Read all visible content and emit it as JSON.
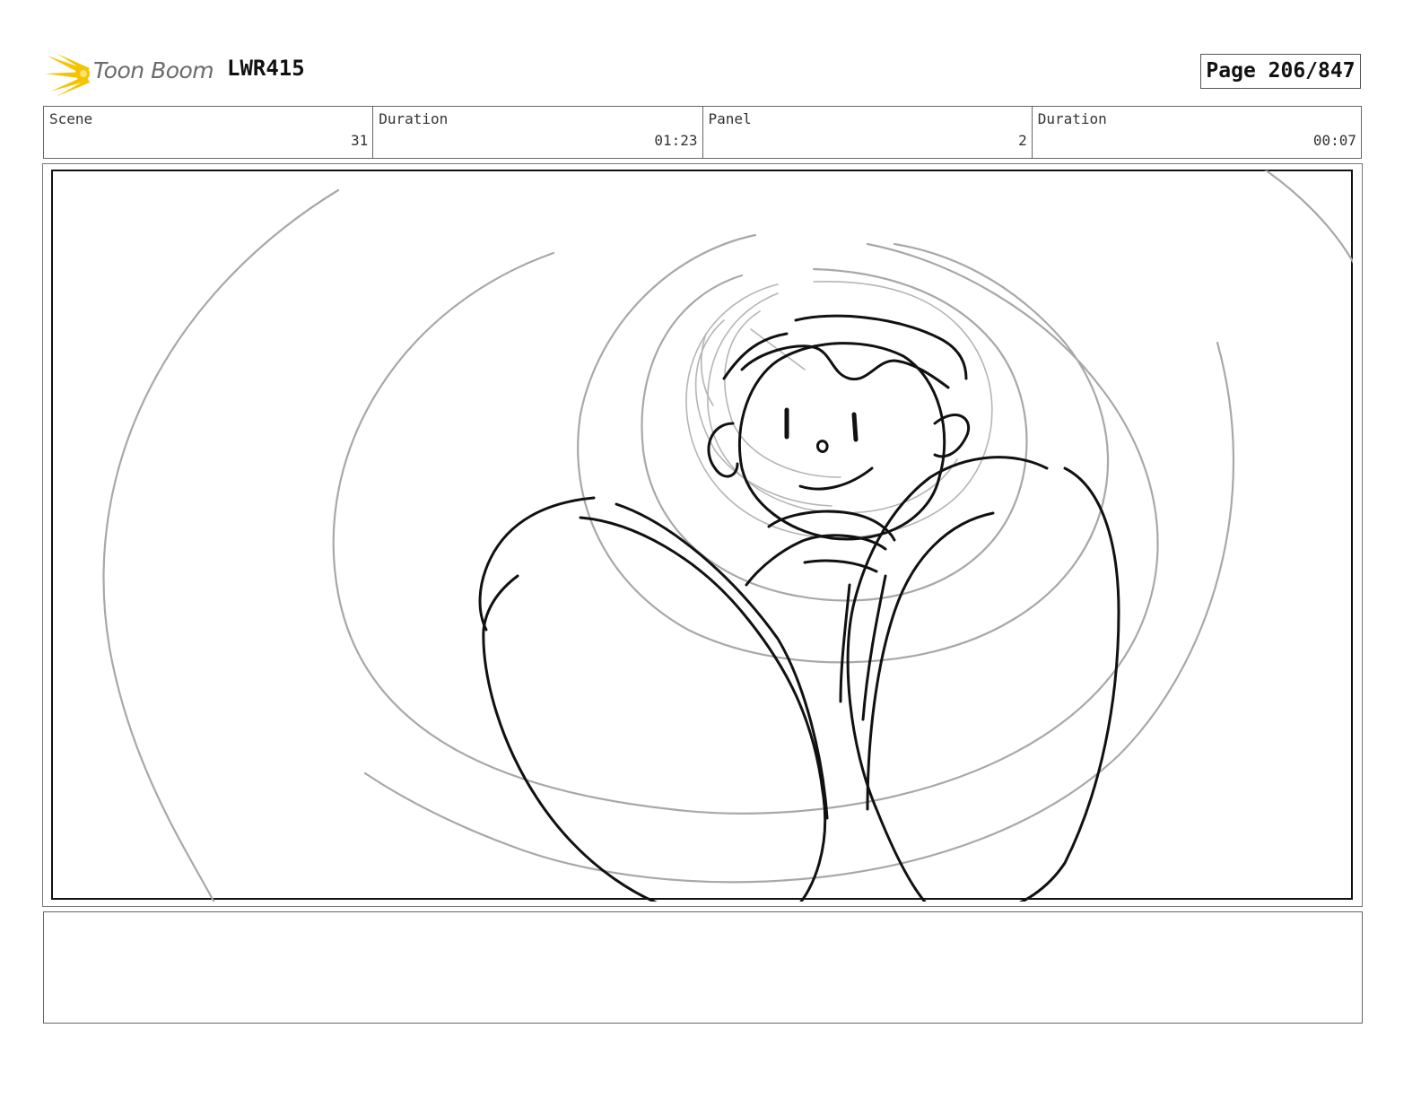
{
  "header": {
    "logo_text": "Toon Boom",
    "project": "LWR415",
    "page": "Page 206/847"
  },
  "info": {
    "scene_label": "Scene",
    "scene_value": "31",
    "scene_duration_label": "Duration",
    "scene_duration_value": "01:23",
    "panel_label": "Panel",
    "panel_value": "2",
    "panel_duration_label": "Duration",
    "panel_duration_value": "00:07"
  },
  "notes": {
    "text": ""
  },
  "colors": {
    "logo_yellow": "#f5c400",
    "sketch_gray": "#a8a8a8",
    "ink_black": "#111111"
  }
}
